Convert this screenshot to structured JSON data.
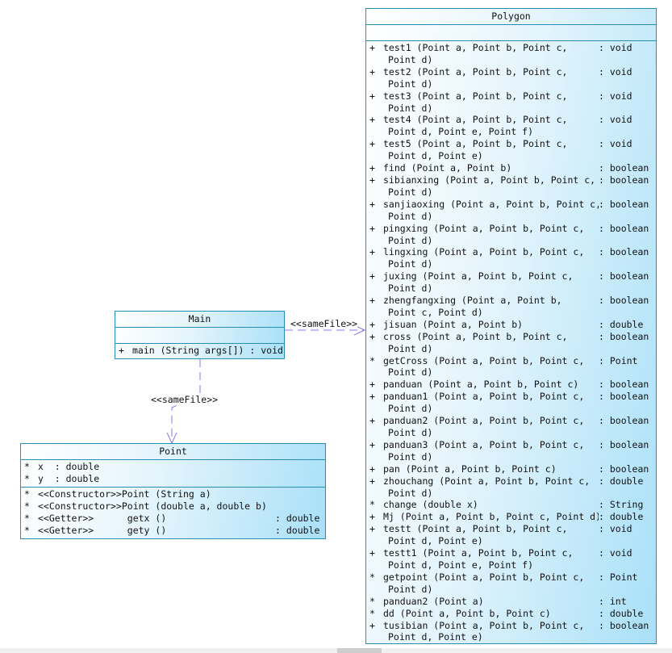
{
  "stereotype_label": "<<sameFile>>",
  "colors": {
    "border": "#2a8db8",
    "arrow": "#8a7be8",
    "fill_end": "#a9e0f8"
  },
  "main_class": {
    "name": "Main",
    "attributes": [],
    "operations": [
      {
        "vis": "+",
        "sig": [
          "main (String args[]) : void"
        ],
        "ret": ""
      }
    ]
  },
  "point_class": {
    "name": "Point",
    "attributes": [
      {
        "vis": "*",
        "sig": [
          "x  : double"
        ],
        "ret": ""
      },
      {
        "vis": "*",
        "sig": [
          "y  : double"
        ],
        "ret": ""
      }
    ],
    "operations": [
      {
        "vis": "*",
        "sig": [
          "<<Constructor>>Point (String a)"
        ],
        "ret": ""
      },
      {
        "vis": "*",
        "sig": [
          "<<Constructor>>Point (double a, double b)"
        ],
        "ret": ""
      },
      {
        "vis": "*",
        "sig": [
          "<<Getter>>      getx ()"
        ],
        "ret": ": double"
      },
      {
        "vis": "*",
        "sig": [
          "<<Getter>>      gety ()"
        ],
        "ret": ": double"
      }
    ]
  },
  "polygon_class": {
    "name": "Polygon",
    "attributes": [],
    "operations": [
      {
        "vis": "+",
        "sig": [
          "test1 (Point a, Point b, Point c,",
          "Point d)"
        ],
        "ret": ": void"
      },
      {
        "vis": "+",
        "sig": [
          "test2 (Point a, Point b, Point c,",
          "Point d)"
        ],
        "ret": ": void"
      },
      {
        "vis": "+",
        "sig": [
          "test3 (Point a, Point b, Point c,",
          "Point d)"
        ],
        "ret": ": void"
      },
      {
        "vis": "+",
        "sig": [
          "test4 (Point a, Point b, Point c,",
          "Point d, Point e, Point f)"
        ],
        "ret": ": void"
      },
      {
        "vis": "+",
        "sig": [
          "test5 (Point a, Point b, Point c,",
          "Point d, Point e)"
        ],
        "ret": ": void"
      },
      {
        "vis": "+",
        "sig": [
          "find (Point a, Point b)"
        ],
        "ret": ": boolean"
      },
      {
        "vis": "+",
        "sig": [
          "sibianxing (Point a, Point b, Point c,",
          "Point d)"
        ],
        "ret": ": boolean"
      },
      {
        "vis": "+",
        "sig": [
          "sanjiaoxing (Point a, Point b, Point c,",
          "Point d)"
        ],
        "ret": ": boolean"
      },
      {
        "vis": "+",
        "sig": [
          "pingxing (Point a, Point b, Point c,",
          "Point d)"
        ],
        "ret": ": boolean"
      },
      {
        "vis": "+",
        "sig": [
          "lingxing (Point a, Point b, Point c,",
          "Point d)"
        ],
        "ret": ": boolean"
      },
      {
        "vis": "+",
        "sig": [
          "juxing (Point a, Point b, Point c,",
          "Point d)"
        ],
        "ret": ": boolean"
      },
      {
        "vis": "+",
        "sig": [
          "zhengfangxing (Point a, Point b,",
          "Point c, Point d)"
        ],
        "ret": ": boolean"
      },
      {
        "vis": "+",
        "sig": [
          "jisuan (Point a, Point b)"
        ],
        "ret": ": double"
      },
      {
        "vis": "+",
        "sig": [
          "cross (Point a, Point b, Point c,",
          "Point d)"
        ],
        "ret": ": boolean"
      },
      {
        "vis": "*",
        "sig": [
          "getCross (Point a, Point b, Point c,",
          "Point d)"
        ],
        "ret": ": Point"
      },
      {
        "vis": "+",
        "sig": [
          "panduan (Point a, Point b, Point c)"
        ],
        "ret": ": boolean"
      },
      {
        "vis": "+",
        "sig": [
          "panduan1 (Point a, Point b, Point c,",
          "Point d)"
        ],
        "ret": ": boolean"
      },
      {
        "vis": "+",
        "sig": [
          "panduan2 (Point a, Point b, Point c,",
          "Point d)"
        ],
        "ret": ": boolean"
      },
      {
        "vis": "+",
        "sig": [
          "panduan3 (Point a, Point b, Point c,",
          "Point d)"
        ],
        "ret": ": boolean"
      },
      {
        "vis": "+",
        "sig": [
          "pan (Point a, Point b, Point c)"
        ],
        "ret": ": boolean"
      },
      {
        "vis": "+",
        "sig": [
          "zhouchang (Point a, Point b, Point c,",
          "Point d)"
        ],
        "ret": ": double"
      },
      {
        "vis": "*",
        "sig": [
          "change (double x)"
        ],
        "ret": ": String"
      },
      {
        "vis": "+",
        "sig": [
          "Mj (Point a, Point b, Point c, Point d)"
        ],
        "ret": ": double"
      },
      {
        "vis": "+",
        "sig": [
          "testt (Point a, Point b, Point c,",
          "Point d, Point e)"
        ],
        "ret": ": void"
      },
      {
        "vis": "+",
        "sig": [
          "testt1 (Point a, Point b, Point c,",
          "Point d, Point e, Point f)"
        ],
        "ret": ": void"
      },
      {
        "vis": "*",
        "sig": [
          "getpoint (Point a, Point b, Point c,",
          "Point d)"
        ],
        "ret": ": Point"
      },
      {
        "vis": "*",
        "sig": [
          "panduan2 (Point a)"
        ],
        "ret": ": int"
      },
      {
        "vis": "*",
        "sig": [
          "dd (Point a, Point b, Point c)"
        ],
        "ret": ": double"
      },
      {
        "vis": "+",
        "sig": [
          "tusibian (Point a, Point b, Point c,",
          "Point d, Point e)"
        ],
        "ret": ": boolean"
      }
    ]
  }
}
